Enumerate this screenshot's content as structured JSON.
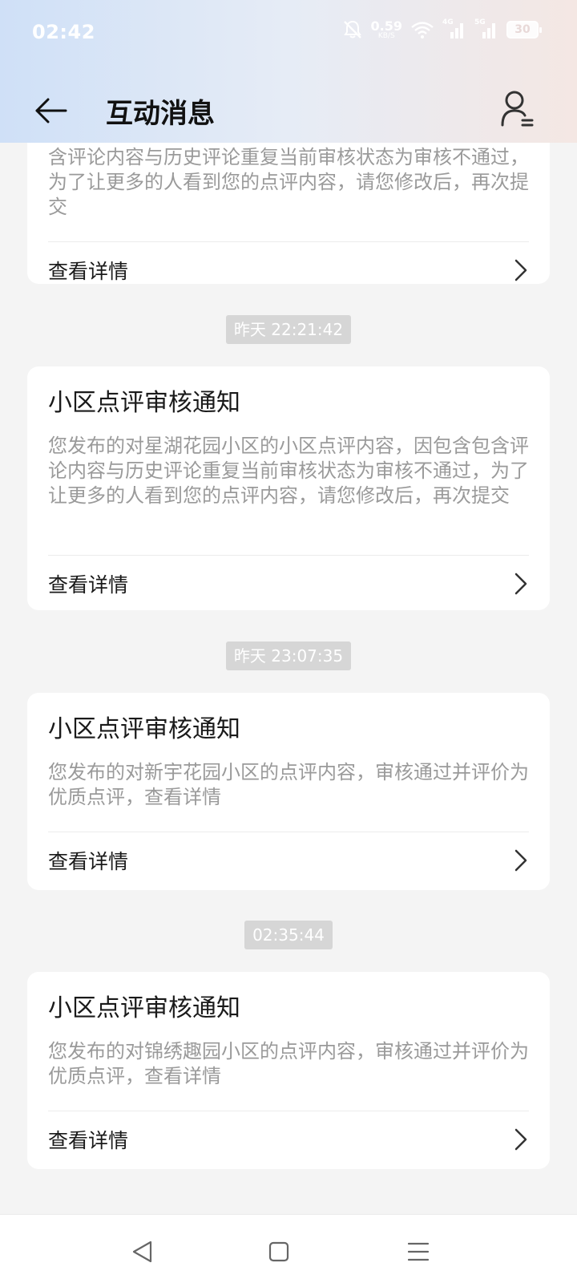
{
  "status_bar": {
    "time": "02:42",
    "net_speed_value": "0.59",
    "net_speed_unit": "KB/S",
    "signal_1_tag": "4G",
    "signal_2_tag": "5G",
    "battery": "30"
  },
  "header": {
    "title": "互动消息"
  },
  "messages": [
    {
      "timestamp": "",
      "title": "",
      "description": "含评论内容与历史评论重复当前审核状态为审核不通过，为了让更多的人看到您的点评内容，请您修改后，再次提交",
      "action_label": "查看详情"
    },
    {
      "timestamp": "昨天 22:21:42",
      "title": "小区点评审核通知",
      "description": "您发布的对星湖花园小区的小区点评内容，因包含包含评论内容与历史评论重复当前审核状态为审核不通过，为了让更多的人看到您的点评内容，请您修改后，再次提交",
      "action_label": "查看详情"
    },
    {
      "timestamp": "昨天 23:07:35",
      "title": "小区点评审核通知",
      "description": "您发布的对新宇花园小区的点评内容，审核通过并评价为优质点评，查看详情",
      "action_label": "查看详情"
    },
    {
      "timestamp": "02:35:44",
      "title": "小区点评审核通知",
      "description": "您发布的对锦绣趣园小区的点评内容，审核通过并评价为优质点评，查看详情",
      "action_label": "查看详情"
    }
  ],
  "colors": {
    "background": "#f4f4f4",
    "card": "#ffffff",
    "description_text": "#9a9a9a",
    "timestamp_bg": "#d6d6d6"
  },
  "icons": {
    "back": "arrow-left-icon",
    "user": "user-list-icon",
    "chevron": "chevron-right-icon",
    "nav_back": "triangle-back-icon",
    "nav_home": "square-home-icon",
    "nav_menu": "three-lines-menu-icon"
  }
}
